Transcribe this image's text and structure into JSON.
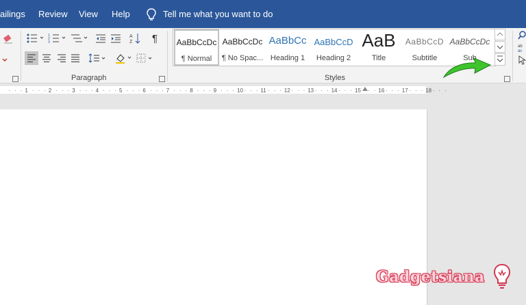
{
  "menu": {
    "items": [
      "ailings",
      "Review",
      "View",
      "Help"
    ],
    "tell_me": "Tell me what you want to do"
  },
  "ribbon": {
    "paragraph_label": "Paragraph",
    "styles_label": "Styles",
    "styles": [
      {
        "preview": "AaBbCcDc",
        "name": "¶ Normal"
      },
      {
        "preview": "AaBbCcDc",
        "name": "¶ No Spac..."
      },
      {
        "preview": "AaBbCc",
        "name": "Heading 1"
      },
      {
        "preview": "AaBbCcD",
        "name": "Heading 2"
      },
      {
        "preview": "AaB",
        "name": "Title"
      },
      {
        "preview": "AaBbCcD",
        "name": "Subtitle"
      },
      {
        "preview": "AaBbCcDc",
        "name": "Sub"
      }
    ]
  },
  "ruler": {
    "numbers": [
      "1",
      "2",
      "3",
      "4",
      "5",
      "6",
      "7",
      "8",
      "9",
      "10",
      "11",
      "12",
      "13",
      "14",
      "15",
      "16",
      "17",
      "18"
    ]
  },
  "watermark": "Gadgetsiana",
  "colors": {
    "menubar": "#2b579a",
    "highlight_arrow": "#3fc42e",
    "heading": "#2e74b5"
  }
}
